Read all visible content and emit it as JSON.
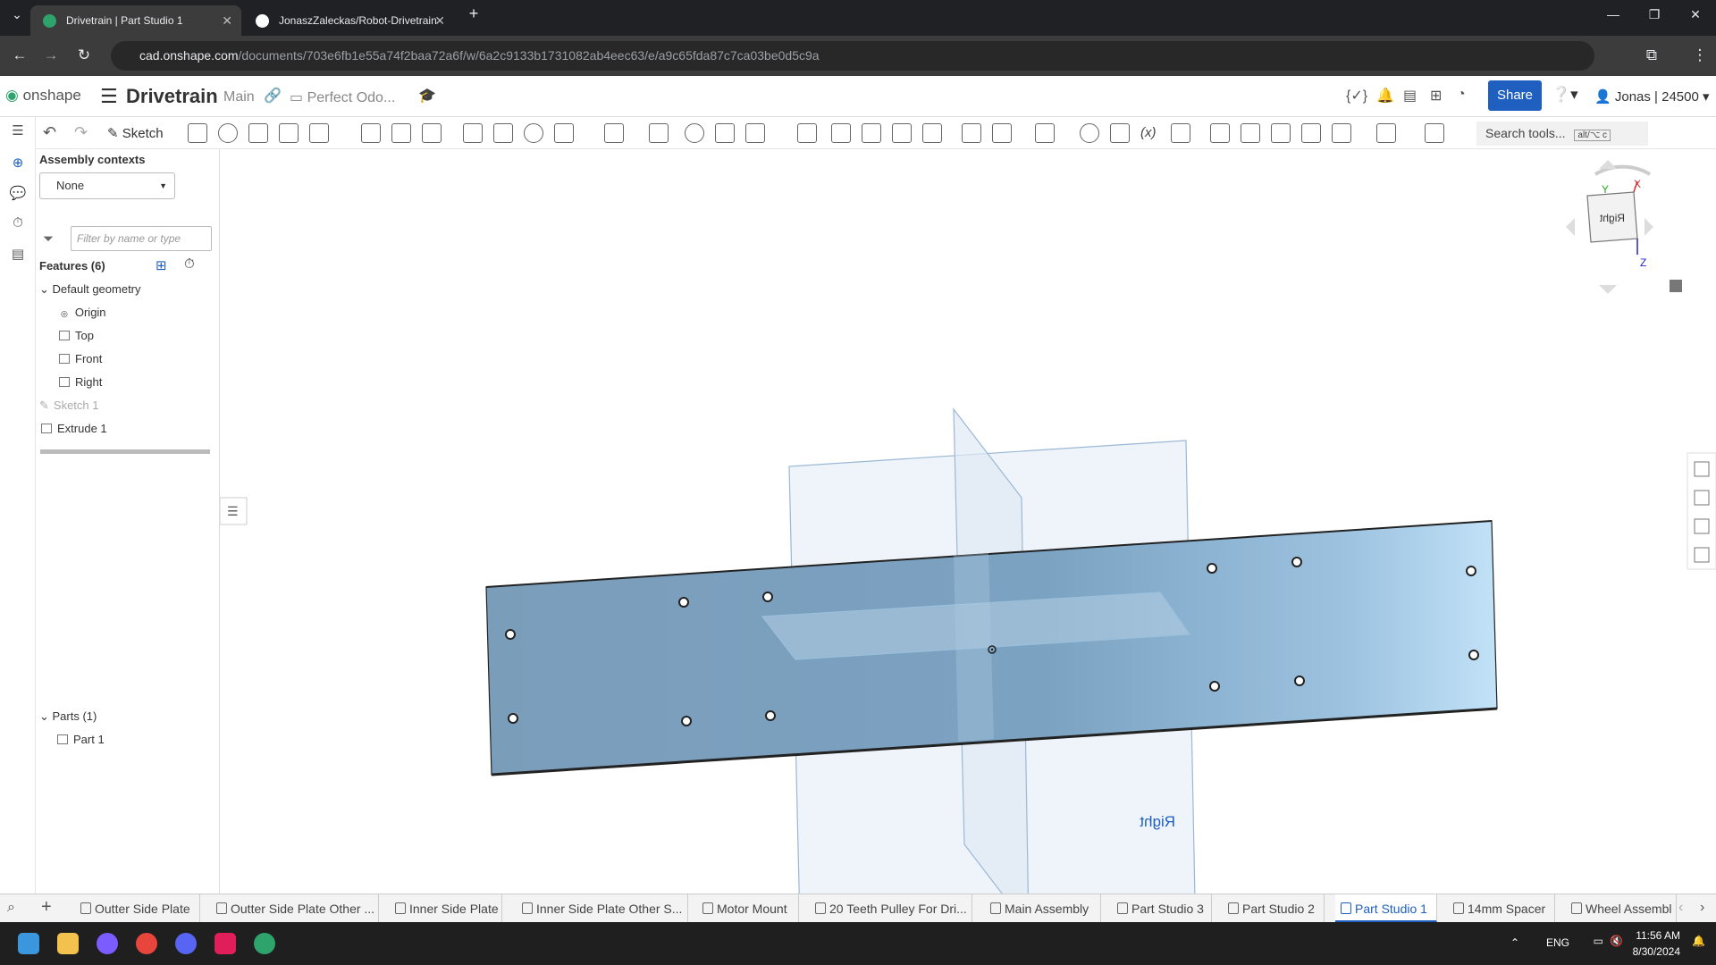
{
  "browser": {
    "tabs": [
      {
        "title": "Drivetrain | Part Studio 1"
      },
      {
        "title": "JonaszZaleckas/Robot-Drivetrain"
      }
    ],
    "url_host": "cad.onshape.com",
    "url_path": "/documents/703e6fb1e55a74f2baa72a6f/w/6a2c9133b1731082ab4eec63/e/a9c65fda87c7ca03be0d5c9a"
  },
  "header": {
    "logo": "onshape",
    "doc_name": "Drivetrain",
    "branch": "Main",
    "folder": "Perfect Odo...",
    "share_label": "Share",
    "user": "Jonas | 24500"
  },
  "toolbar": {
    "sketch_label": "Sketch",
    "search_placeholder": "Search tools...",
    "search_shortcut": "alt/⌥ c"
  },
  "panel": {
    "assembly_contexts_label": "Assembly contexts",
    "context_value": "None",
    "filter_placeholder": "Filter by name or type",
    "features_header": "Features (6)",
    "default_geometry": "Default geometry",
    "items": [
      "Origin",
      "Top",
      "Front",
      "Right"
    ],
    "sketch1": "Sketch 1",
    "extrude1": "Extrude 1",
    "parts_header": "Parts (1)",
    "part1": "Part 1"
  },
  "viewport": {
    "right_plane_label": "Right",
    "viewcube_label": "Right",
    "axis_x": "X",
    "axis_y": "Y",
    "axis_z": "Z",
    "plate_color": "#7ea4c4"
  },
  "bottom_tabs": [
    "Outter Side Plate",
    "Outter Side Plate Other ...",
    "Inner Side Plate",
    "Inner Side Plate Other S...",
    "Motor Mount",
    "20 Teeth Pulley For Dri...",
    "Main Assembly",
    "Part Studio 3",
    "Part Studio 2",
    "Part Studio 1",
    "14mm Spacer",
    "Wheel Assembl"
  ],
  "taskbar": {
    "lang": "ENG",
    "time": "11:56 AM",
    "date": "8/30/2024"
  }
}
